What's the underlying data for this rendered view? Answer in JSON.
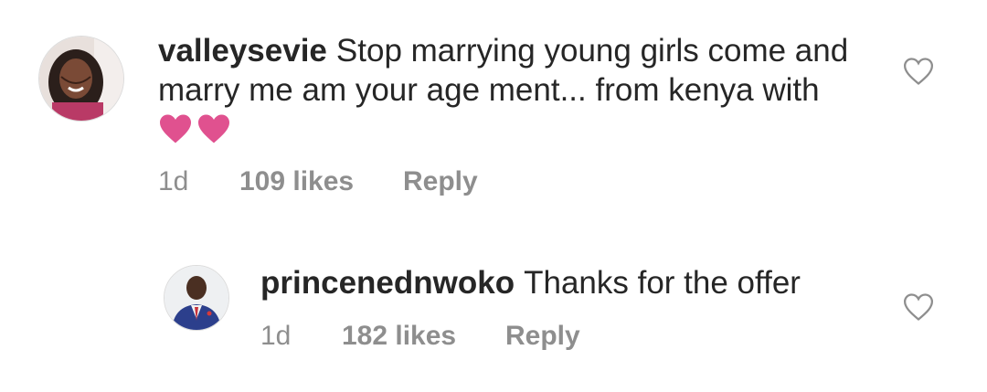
{
  "comments": [
    {
      "username": "valleysevie",
      "text": "Stop marrying young girls come and marry me am your age ment... from kenya with",
      "emoji": [
        "heart-emoji",
        "heart-emoji"
      ],
      "time": "1d",
      "likes": "109 likes",
      "reply_label": "Reply"
    },
    {
      "username": "princenednwoko",
      "text": "Thanks for the offer",
      "time": "1d",
      "likes": "182 likes",
      "reply_label": "Reply"
    }
  ],
  "colors": {
    "text": "#262626",
    "muted": "#8e8e8e",
    "heart_emoji": "#e0518f"
  }
}
